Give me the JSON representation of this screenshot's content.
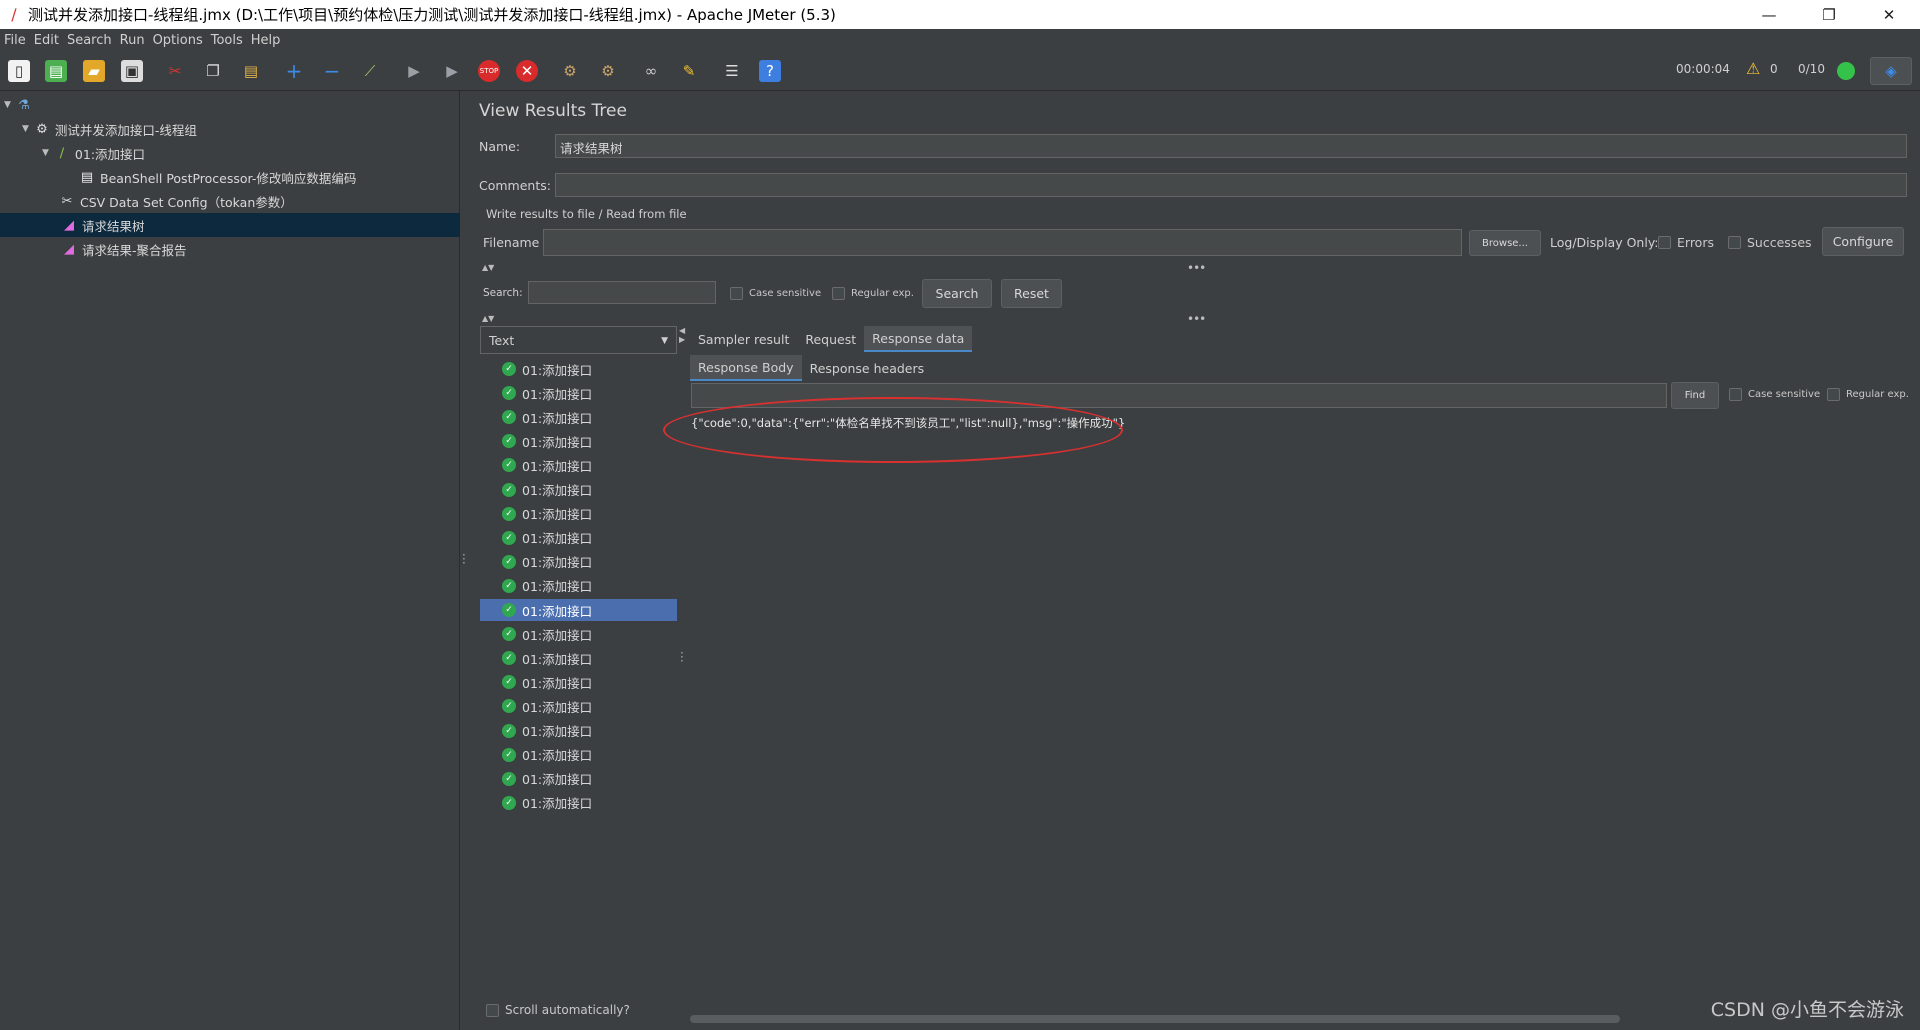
{
  "window": {
    "title": "测试并发添加接口-线程组.jmx (D:\\工作\\项目\\预约体检\\压力测试\\测试并发添加接口-线程组.jmx) - Apache JMeter (5.3)",
    "minimize": "—",
    "restore": "❐",
    "close": "✕"
  },
  "menu": {
    "items": [
      "File",
      "Edit",
      "Search",
      "Run",
      "Options",
      "Tools",
      "Help"
    ]
  },
  "toolbar": {
    "elapsed": "00:00:04",
    "warnings": "0",
    "threads": "0/10"
  },
  "tree": {
    "root_icon": "test-plan-icon",
    "items": [
      {
        "label": "测试并发添加接口-线程组",
        "icon": "gear-icon"
      },
      {
        "label": "01:添加接口",
        "icon": "pipette-icon"
      },
      {
        "label": "BeanShell PostProcessor-修改响应数据编码",
        "icon": "script-icon"
      },
      {
        "label": "CSV Data Set Config（tokan参数）",
        "icon": "scissors-config-icon"
      },
      {
        "label": "请求结果树",
        "icon": "chart-icon"
      },
      {
        "label": "请求结果-聚合报告",
        "icon": "chart-icon"
      }
    ]
  },
  "panel": {
    "title": "View Results Tree",
    "name_label": "Name:",
    "name_value": "请求结果树",
    "comments_label": "Comments:",
    "comments_value": "",
    "write_results_label": "Write results to file / Read from file",
    "filename_label": "Filename",
    "filename_value": "",
    "browse_label": "Browse...",
    "log_display_label": "Log/Display Only:",
    "errors_label": "Errors",
    "successes_label": "Successes",
    "configure_label": "Configure",
    "search_label": "Search:",
    "search_value": "",
    "case_sensitive_label": "Case sensitive",
    "regex_label": "Regular exp.",
    "search_button": "Search",
    "reset_button": "Reset",
    "renderer": "Text",
    "scroll_auto_label": "Scroll automatically?"
  },
  "samples": {
    "label": "01:添加接口",
    "count": 19,
    "selected_index": 10
  },
  "tabs": {
    "main": [
      "Sampler result",
      "Request",
      "Response data"
    ],
    "active_main": "Response data",
    "sub": [
      "Response Body",
      "Response headers"
    ],
    "active_sub": "Response Body"
  },
  "find": {
    "value": "",
    "button": "Find",
    "case_sensitive_label": "Case sensitive",
    "regex_label": "Regular exp."
  },
  "response": {
    "body": "{\"code\":0,\"data\":{\"err\":\"体检名单找不到该员工\",\"list\":null},\"msg\":\"操作成功\"}"
  },
  "watermark": "CSDN @小鱼不会游泳"
}
